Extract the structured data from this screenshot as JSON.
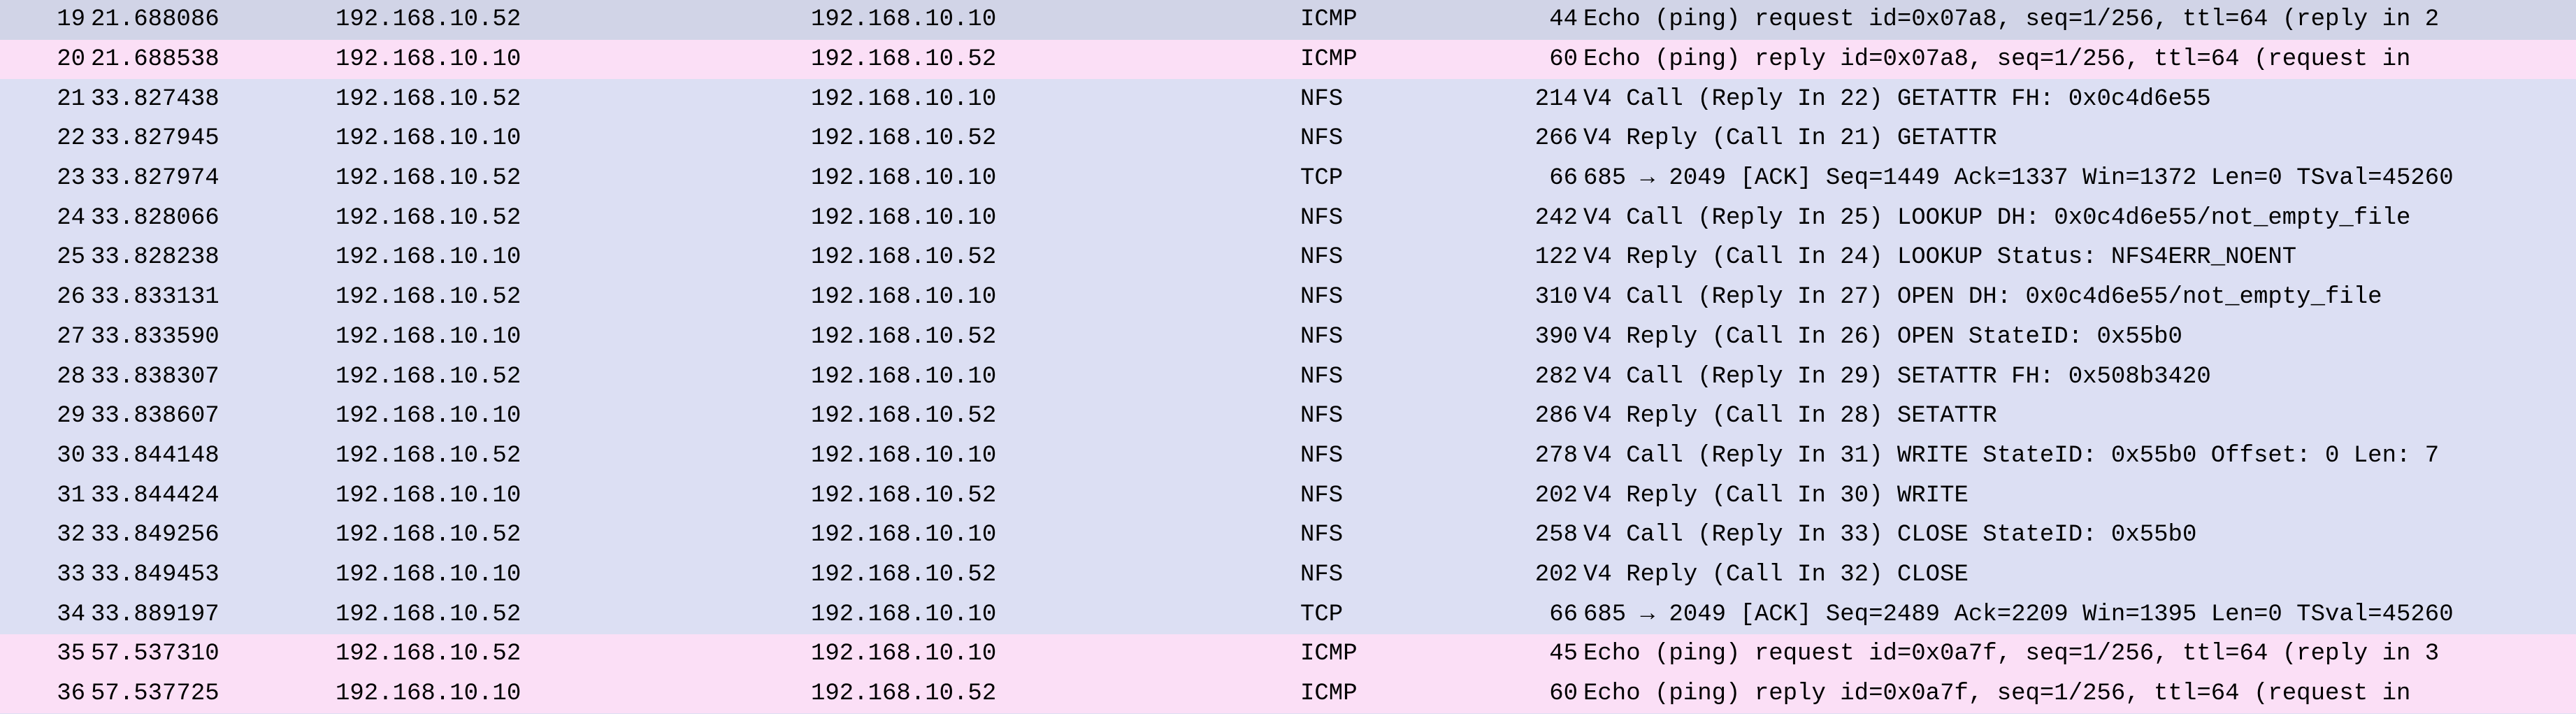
{
  "packets": [
    {
      "no": "19",
      "time": "21.688086",
      "source": "192.168.10.52",
      "destination": "192.168.10.10",
      "protocol": "ICMP",
      "length": "44",
      "info": "Echo (ping) request  id=0x07a8, seq=1/256, ttl=64 (reply in 2",
      "rowClass": "icmp-request"
    },
    {
      "no": "20",
      "time": "21.688538",
      "source": "192.168.10.10",
      "destination": "192.168.10.52",
      "protocol": "ICMP",
      "length": "60",
      "info": "Echo (ping) reply    id=0x07a8, seq=1/256, ttl=64 (request in",
      "rowClass": "icmp-reply"
    },
    {
      "no": "21",
      "time": "33.827438",
      "source": "192.168.10.52",
      "destination": "192.168.10.10",
      "protocol": "NFS",
      "length": "214",
      "info": "V4 Call (Reply In 22) GETATTR FH: 0x0c4d6e55",
      "rowClass": "nfs"
    },
    {
      "no": "22",
      "time": "33.827945",
      "source": "192.168.10.10",
      "destination": "192.168.10.52",
      "protocol": "NFS",
      "length": "266",
      "info": "V4 Reply (Call In 21) GETATTR",
      "rowClass": "nfs"
    },
    {
      "no": "23",
      "time": "33.827974",
      "source": "192.168.10.52",
      "destination": "192.168.10.10",
      "protocol": "TCP",
      "length": "66",
      "info": "685 → 2049 [ACK] Seq=1449 Ack=1337 Win=1372 Len=0 TSval=45260",
      "rowClass": "tcp"
    },
    {
      "no": "24",
      "time": "33.828066",
      "source": "192.168.10.52",
      "destination": "192.168.10.10",
      "protocol": "NFS",
      "length": "242",
      "info": "V4 Call (Reply In 25) LOOKUP DH: 0x0c4d6e55/not_empty_file",
      "rowClass": "nfs"
    },
    {
      "no": "25",
      "time": "33.828238",
      "source": "192.168.10.10",
      "destination": "192.168.10.52",
      "protocol": "NFS",
      "length": "122",
      "info": "V4 Reply (Call In 24) LOOKUP Status: NFS4ERR_NOENT",
      "rowClass": "nfs"
    },
    {
      "no": "26",
      "time": "33.833131",
      "source": "192.168.10.52",
      "destination": "192.168.10.10",
      "protocol": "NFS",
      "length": "310",
      "info": "V4 Call (Reply In 27) OPEN DH: 0x0c4d6e55/not_empty_file",
      "rowClass": "nfs"
    },
    {
      "no": "27",
      "time": "33.833590",
      "source": "192.168.10.10",
      "destination": "192.168.10.52",
      "protocol": "NFS",
      "length": "390",
      "info": "V4 Reply (Call In 26) OPEN StateID: 0x55b0",
      "rowClass": "nfs"
    },
    {
      "no": "28",
      "time": "33.838307",
      "source": "192.168.10.52",
      "destination": "192.168.10.10",
      "protocol": "NFS",
      "length": "282",
      "info": "V4 Call (Reply In 29) SETATTR FH: 0x508b3420",
      "rowClass": "nfs"
    },
    {
      "no": "29",
      "time": "33.838607",
      "source": "192.168.10.10",
      "destination": "192.168.10.52",
      "protocol": "NFS",
      "length": "286",
      "info": "V4 Reply (Call In 28) SETATTR",
      "rowClass": "nfs"
    },
    {
      "no": "30",
      "time": "33.844148",
      "source": "192.168.10.52",
      "destination": "192.168.10.10",
      "protocol": "NFS",
      "length": "278",
      "info": "V4 Call (Reply In 31) WRITE StateID: 0x55b0 Offset: 0 Len: 7",
      "rowClass": "nfs"
    },
    {
      "no": "31",
      "time": "33.844424",
      "source": "192.168.10.10",
      "destination": "192.168.10.52",
      "protocol": "NFS",
      "length": "202",
      "info": "V4 Reply (Call In 30) WRITE",
      "rowClass": "nfs"
    },
    {
      "no": "32",
      "time": "33.849256",
      "source": "192.168.10.52",
      "destination": "192.168.10.10",
      "protocol": "NFS",
      "length": "258",
      "info": "V4 Call (Reply In 33) CLOSE StateID: 0x55b0",
      "rowClass": "nfs"
    },
    {
      "no": "33",
      "time": "33.849453",
      "source": "192.168.10.10",
      "destination": "192.168.10.52",
      "protocol": "NFS",
      "length": "202",
      "info": "V4 Reply (Call In 32) CLOSE",
      "rowClass": "nfs"
    },
    {
      "no": "34",
      "time": "33.889197",
      "source": "192.168.10.52",
      "destination": "192.168.10.10",
      "protocol": "TCP",
      "length": "66",
      "info": "685 → 2049 [ACK] Seq=2489 Ack=2209 Win=1395 Len=0 TSval=45260",
      "rowClass": "tcp"
    },
    {
      "no": "35",
      "time": "57.537310",
      "source": "192.168.10.52",
      "destination": "192.168.10.10",
      "protocol": "ICMP",
      "length": "45",
      "info": "Echo (ping) request  id=0x0a7f, seq=1/256, ttl=64 (reply in 3",
      "rowClass": "icmp-reply"
    },
    {
      "no": "36",
      "time": "57.537725",
      "source": "192.168.10.10",
      "destination": "192.168.10.52",
      "protocol": "ICMP",
      "length": "60",
      "info": "Echo (ping) reply    id=0x0a7f, seq=1/256, ttl=64 (request in",
      "rowClass": "icmp-reply"
    }
  ]
}
